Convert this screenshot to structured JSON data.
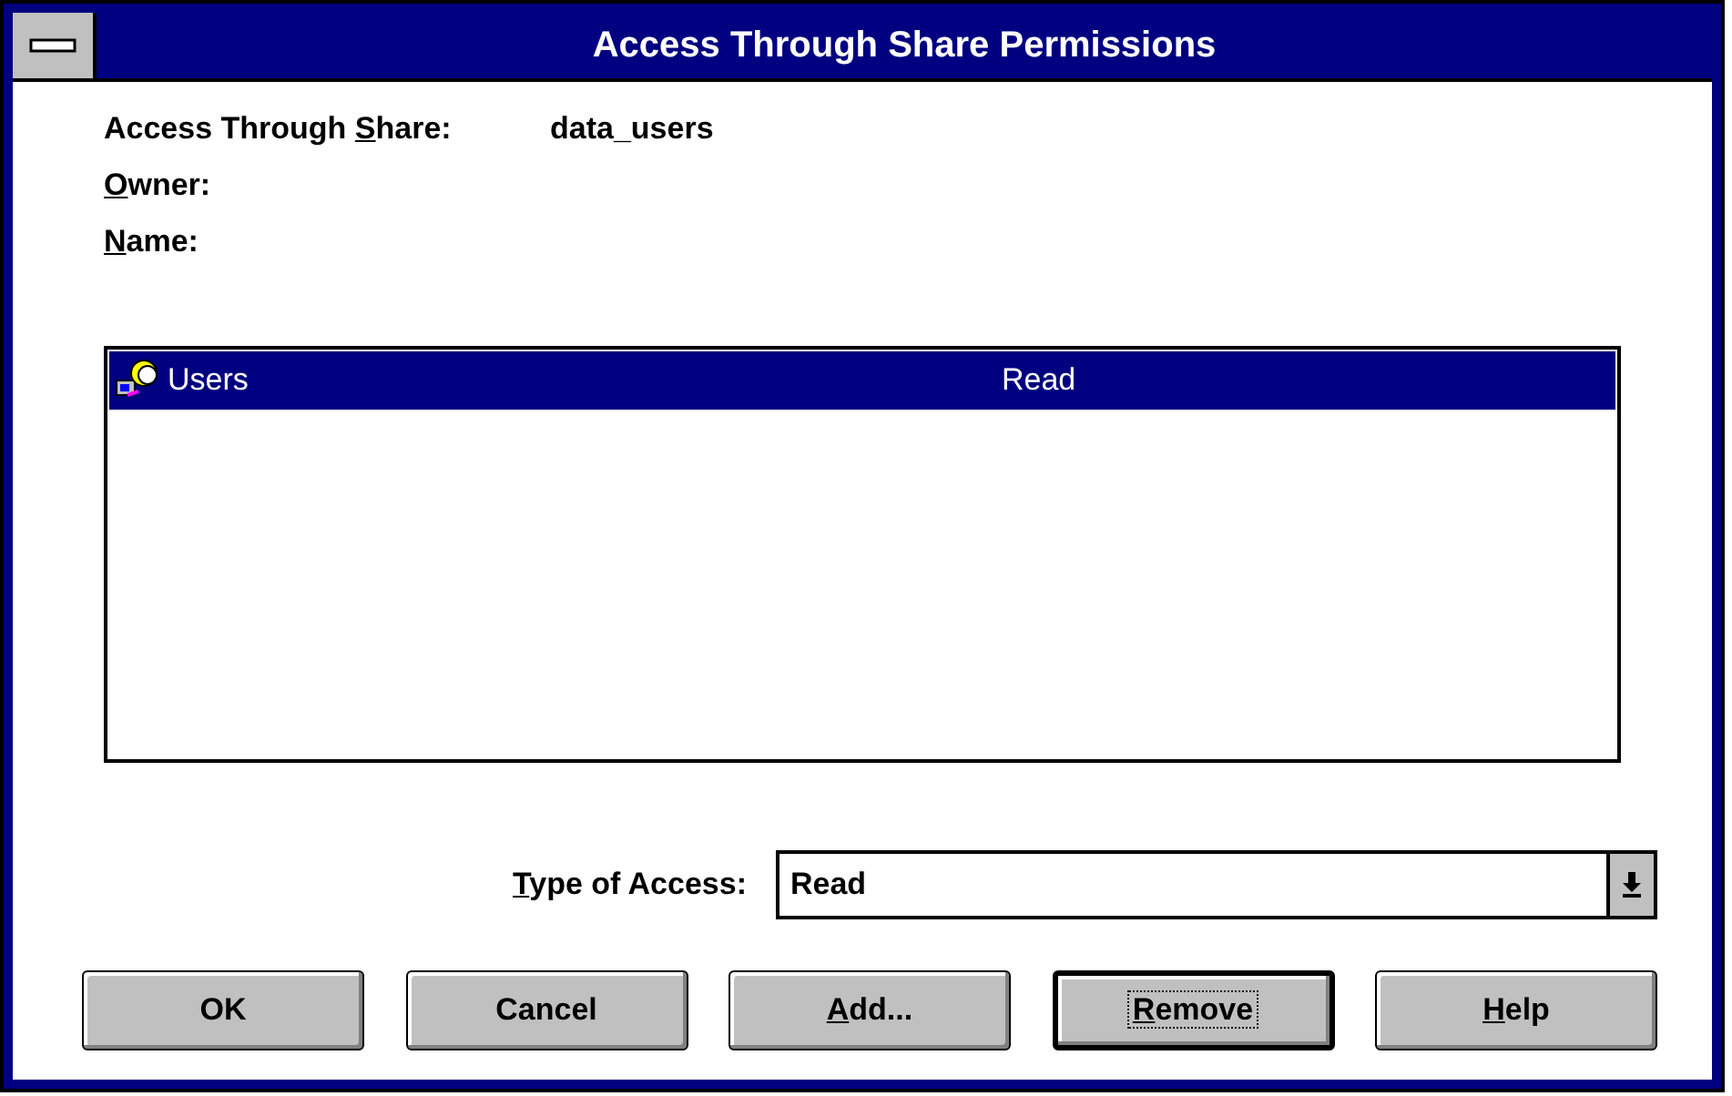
{
  "window": {
    "title": "Access Through Share Permissions"
  },
  "fields": [
    {
      "label": {
        "before": "Access Through ",
        "key": "S",
        "after": "hare:"
      },
      "value": "data_users"
    },
    {
      "label": {
        "key": "O",
        "after": "wner:"
      }
    },
    {
      "label": {
        "key": "N",
        "after": "ame:"
      }
    }
  ],
  "permissions": [
    {
      "name": "Users",
      "access": "Read",
      "selected": true
    }
  ],
  "type_of_access": {
    "label": {
      "key": "T",
      "after": "ype of Access:"
    },
    "value": "Read"
  },
  "buttons": [
    {
      "label": {
        "before": "OK"
      },
      "default": false
    },
    {
      "label": {
        "before": "Cancel"
      },
      "default": false
    },
    {
      "label": {
        "key": "A",
        "after": "dd..."
      },
      "default": false
    },
    {
      "label": {
        "key": "R",
        "after": "emove"
      },
      "default": true
    },
    {
      "label": {
        "key": "H",
        "after": "elp"
      },
      "default": false
    }
  ]
}
